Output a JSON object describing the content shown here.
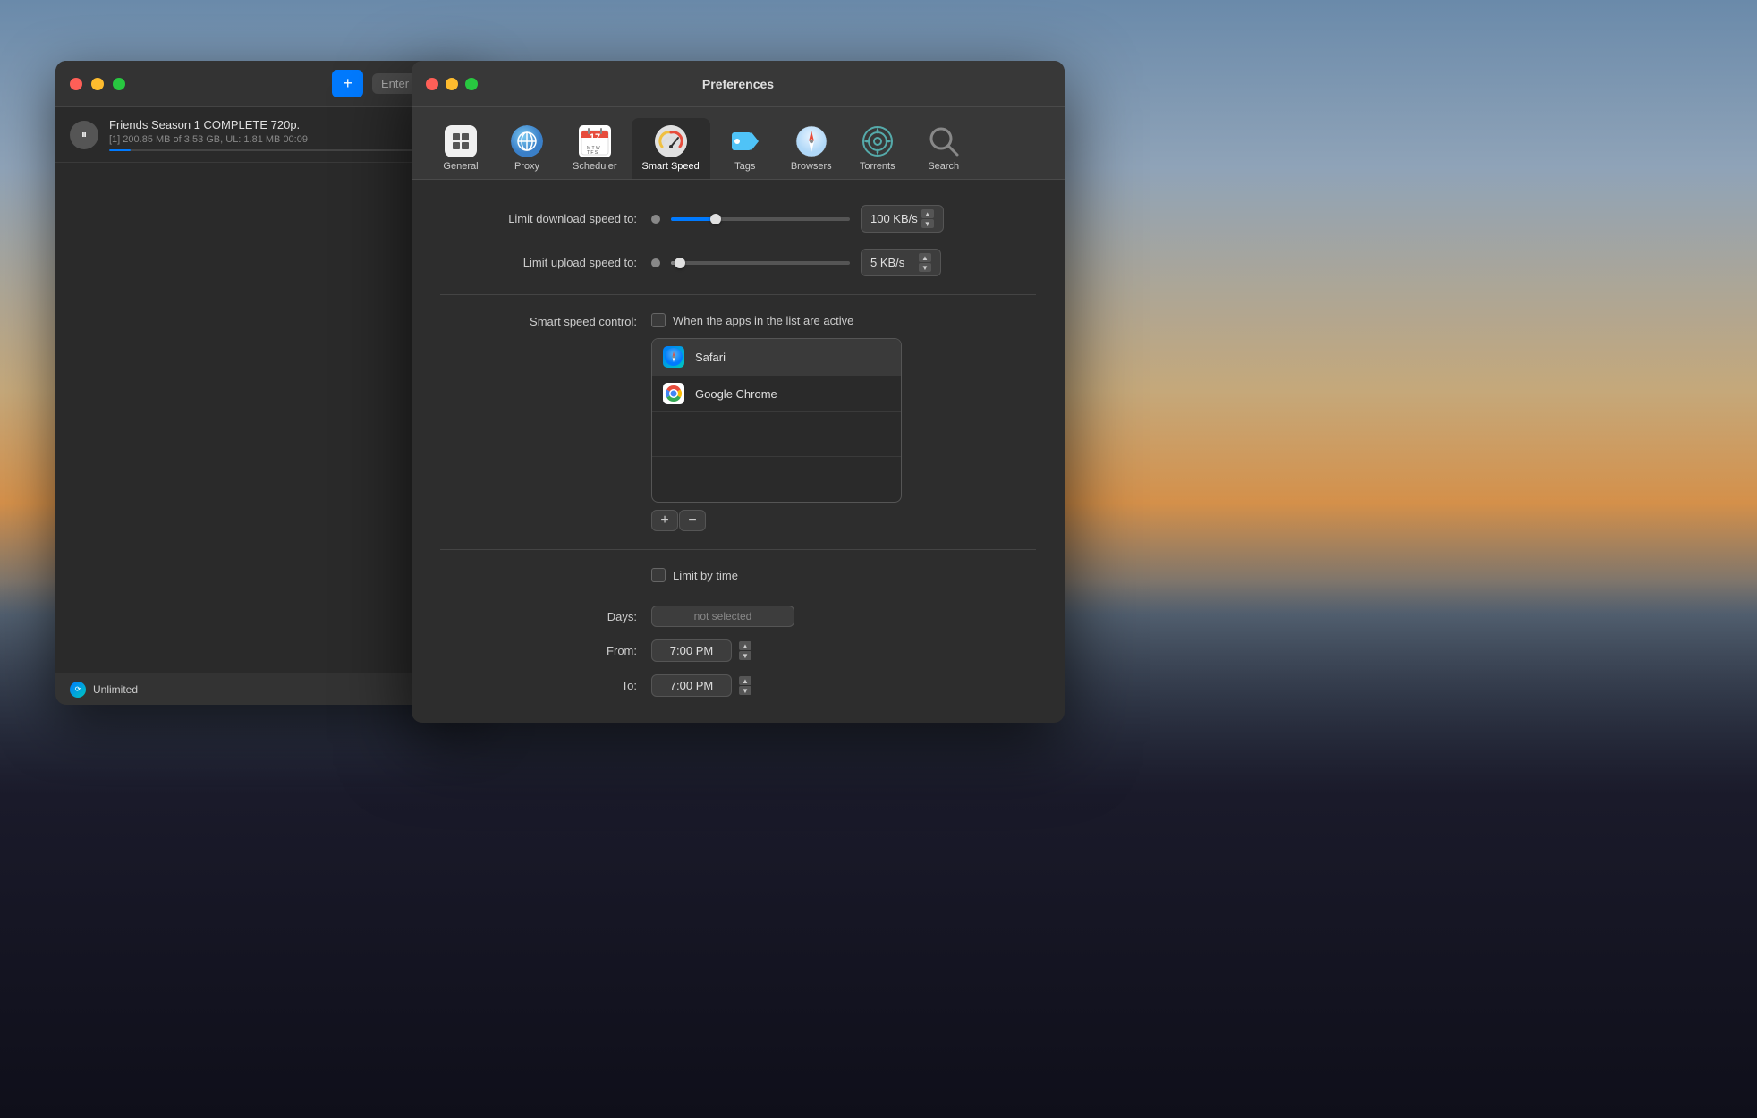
{
  "background": {
    "gradient": "cityscape"
  },
  "torrent_window": {
    "title": "",
    "buttons": {
      "add": "+",
      "search_placeholder": "Enter U"
    },
    "item": {
      "name": "Friends Season 1 COMPLETE 720p.",
      "details": "[1] 200.85 MB of 3.53 GB, UL: 1.81 MB 00:09",
      "progress_percent": 6
    },
    "status": {
      "icon": "⟳",
      "text": "Unlimited"
    }
  },
  "prefs_window": {
    "title": "Preferences",
    "tabs": [
      {
        "id": "general",
        "label": "General",
        "icon": "general"
      },
      {
        "id": "proxy",
        "label": "Proxy",
        "icon": "proxy"
      },
      {
        "id": "scheduler",
        "label": "Scheduler",
        "icon": "scheduler"
      },
      {
        "id": "smart_speed",
        "label": "Smart Speed",
        "icon": "smart_speed",
        "active": true
      },
      {
        "id": "tags",
        "label": "Tags",
        "icon": "tags"
      },
      {
        "id": "browsers",
        "label": "Browsers",
        "icon": "browsers"
      },
      {
        "id": "torrents",
        "label": "Torrents",
        "icon": "torrents"
      },
      {
        "id": "search",
        "label": "Search",
        "icon": "search"
      }
    ],
    "content": {
      "limit_download": {
        "label": "Limit download speed to:",
        "value": "100 KB/s"
      },
      "limit_upload": {
        "label": "Limit upload speed to:",
        "value": "5 KB/s"
      },
      "smart_speed_control": {
        "label": "Smart speed control:",
        "checkbox_label": "When the apps in the list are active",
        "checked": false
      },
      "app_list": [
        {
          "name": "Safari",
          "icon": "safari"
        },
        {
          "name": "Google Chrome",
          "icon": "chrome"
        }
      ],
      "list_buttons": {
        "add": "+",
        "remove": "−"
      },
      "limit_by_time": {
        "label": "Limit by time",
        "checked": false
      },
      "days": {
        "label": "Days:",
        "value": "not selected"
      },
      "from": {
        "label": "From:",
        "value": "7:00 PM"
      },
      "to": {
        "label": "To:",
        "value": "7:00 PM"
      }
    }
  }
}
